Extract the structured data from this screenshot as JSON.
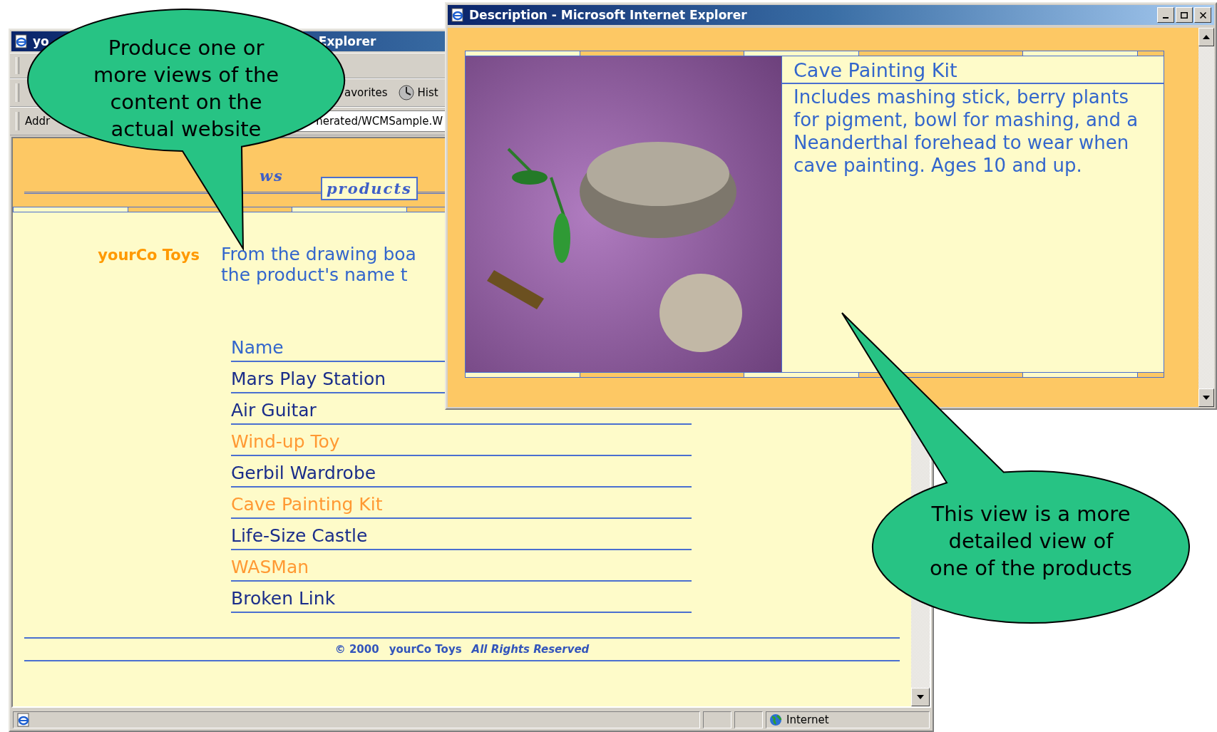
{
  "main_window": {
    "title_start": "yo",
    "title_end": "Explorer",
    "toolbar": {
      "favorites": "avorites",
      "history": "Hist"
    },
    "address": {
      "label": "Addr",
      "value": "nerated/WCMSample.W"
    },
    "nav": [
      {
        "label": "ws",
        "selected": false
      },
      {
        "label": "products",
        "selected": true
      }
    ],
    "logo": "yourCo Toys",
    "intro": [
      "From the drawing boa",
      "the product's name t"
    ],
    "table": {
      "header": "Name",
      "rows": [
        {
          "name": "Mars Play Station",
          "visited": false
        },
        {
          "name": "Air Guitar",
          "visited": false
        },
        {
          "name": "Wind-up Toy",
          "visited": true
        },
        {
          "name": "Gerbil Wardrobe",
          "visited": false
        },
        {
          "name": "Cave Painting Kit",
          "visited": true
        },
        {
          "name": "Life-Size Castle",
          "visited": false
        },
        {
          "name": "WASMan",
          "visited": true
        },
        {
          "name": "Broken Link",
          "visited": false
        }
      ]
    },
    "footer": {
      "copyright": "© 2000",
      "company": "yourCo Toys",
      "rights": "All Rights Reserved"
    },
    "status_bar": {
      "zone": "Internet"
    }
  },
  "description_window": {
    "title": "Description - Microsoft Internet Explorer",
    "heading": "Cave Painting Kit",
    "text": "Includes mashing stick, berry plants for pigment, bowl for mashing, and a Neanderthal forehead to wear when cave painting. Ages 10 and up."
  },
  "callouts": [
    {
      "text": "Produce one or\nmore views of the\ncontent on the\nactual website"
    },
    {
      "text": "This view is a more\ndetailed view of\none of the products"
    }
  ]
}
